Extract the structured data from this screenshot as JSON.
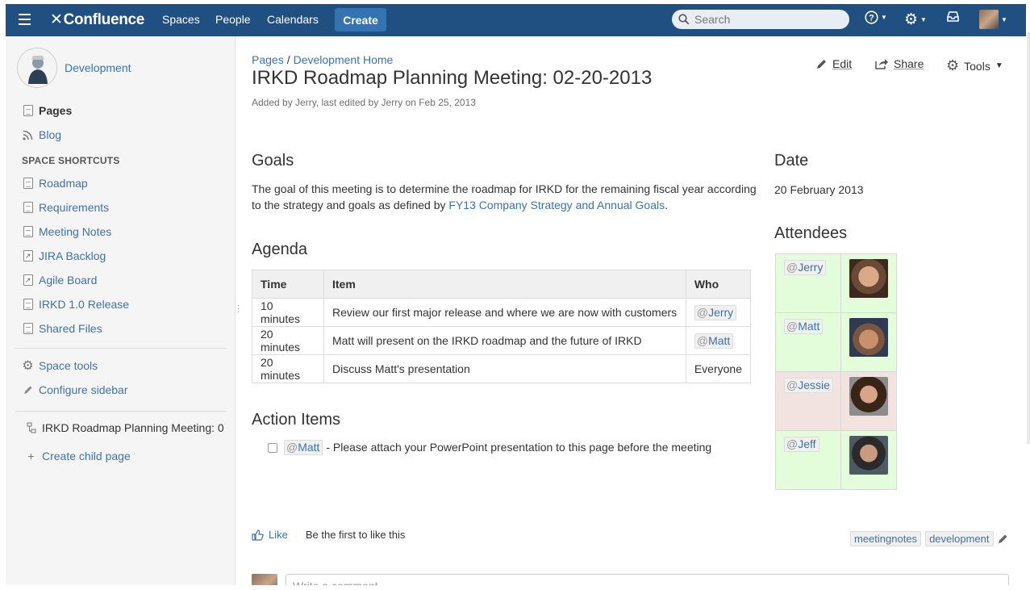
{
  "nav": {
    "logo": "Confluence",
    "links": [
      "Spaces",
      "People",
      "Calendars"
    ],
    "create_label": "Create",
    "search_placeholder": "Search"
  },
  "sidebar": {
    "space_name": "Development",
    "pages_label": "Pages",
    "blog_label": "Blog",
    "shortcuts_heading": "SPACE SHORTCUTS",
    "shortcuts": [
      "Roadmap",
      "Requirements",
      "Meeting Notes",
      "JIRA Backlog",
      "Agile Board",
      "IRKD 1.0 Release",
      "Shared Files"
    ],
    "space_tools": "Space tools",
    "configure_sidebar": "Configure sidebar",
    "current_page": "IRKD Roadmap Planning Meeting: 0",
    "create_child": "Create child page"
  },
  "page": {
    "breadcrumb": [
      "Pages",
      "Development Home"
    ],
    "title": "IRKD Roadmap Planning Meeting: 02-20-2013",
    "byline": "Added by Jerry, last edited by Jerry on Feb 25, 2013",
    "actions": {
      "edit": "Edit",
      "share": "Share",
      "tools": "Tools"
    }
  },
  "goals": {
    "heading": "Goals",
    "text_before": "The goal of this meeting is to determine the roadmap for IRKD for the remaining fiscal year according to the strategy and goals as defined by ",
    "link": "FY13 Company Strategy and Annual Goals",
    "text_after": "."
  },
  "agenda": {
    "heading": "Agenda",
    "columns": [
      "Time",
      "Item",
      "Who"
    ],
    "rows": [
      {
        "time": "10 minutes",
        "item": "Review our first major release and where we are now with customers",
        "who": "Jerry",
        "mention": true
      },
      {
        "time": "20 minutes",
        "item": "Matt will present on the IRKD roadmap and the future of IRKD",
        "who": "Matt",
        "mention": true
      },
      {
        "time": "20 minutes",
        "item": "Discuss Matt's presentation",
        "who": "Everyone",
        "mention": false
      }
    ]
  },
  "action_items": {
    "heading": "Action Items",
    "items": [
      {
        "mention": "Matt",
        "text": " - Please attach your PowerPoint presentation to this page before the meeting"
      }
    ]
  },
  "date": {
    "heading": "Date",
    "value": "20 February 2013"
  },
  "attendees": {
    "heading": "Attendees",
    "people": [
      {
        "name": "Jerry",
        "bg": "#e3fcd9"
      },
      {
        "name": "Matt",
        "bg": "#e3fcd9"
      },
      {
        "name": "Jessie",
        "bg": "#f2e3e0"
      },
      {
        "name": "Jeff",
        "bg": "#e3fcd9"
      }
    ]
  },
  "footer": {
    "like": "Like",
    "like_text": "Be the first to like this",
    "labels": [
      "meetingnotes",
      "development"
    ],
    "comment_placeholder": "Write a comment..."
  },
  "colors": {
    "header": "#205081",
    "link": "#3b73af",
    "create": "#3572b0"
  }
}
